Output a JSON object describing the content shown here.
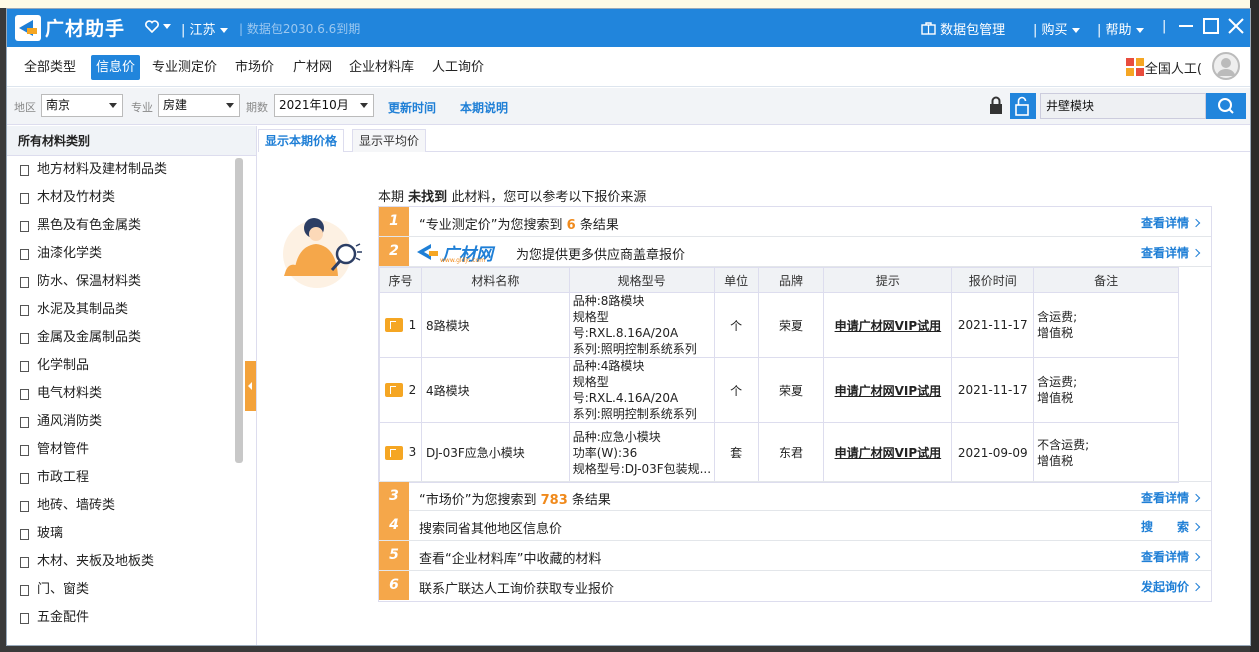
{
  "titlebar": {
    "app_name": "广材助手",
    "region": "江苏",
    "package_expiry": "数据包2030.6.6到期",
    "data_package_manage": "数据包管理",
    "buy": "购买",
    "help": "帮助"
  },
  "nav": {
    "tabs": [
      {
        "label": "全部类型"
      },
      {
        "label": "信息价"
      },
      {
        "label": "专业测定价"
      },
      {
        "label": "市场价"
      },
      {
        "label": "广材网"
      },
      {
        "label": "企业材料库"
      },
      {
        "label": "人工询价"
      }
    ],
    "right_label": "全国人工("
  },
  "filters": {
    "region_label": "地区",
    "region_value": "南京",
    "specialty_label": "专业",
    "specialty_value": "房建",
    "period_label": "期数",
    "period_value": "2021年10月",
    "update_time": "更新时间",
    "period_desc": "本期说明",
    "search_value": "井壁模块"
  },
  "sidebar": {
    "header": "所有材料类别",
    "items": [
      "地方材料及建材制品类",
      "木材及竹材类",
      "黑色及有色金属类",
      "油漆化学类",
      "防水、保温材料类",
      "水泥及其制品类",
      "金属及金属制品类",
      "化学制品",
      "电气材料类",
      "通风消防类",
      "管材管件",
      "市政工程",
      "地砖、墙砖类",
      "玻璃",
      "木材、夹板及地板类",
      "门、窗类",
      "五金配件"
    ]
  },
  "main": {
    "subtabs": [
      "显示本期价格",
      "显示平均价"
    ],
    "notice_prefix": "本期",
    "notice_bold": "未找到",
    "notice_suffix": "此材料，您可以参考以下报价来源",
    "rows": [
      {
        "num": "1",
        "text_pre": "“专业测定价”为您搜索到",
        "count": "6",
        "text_post": "条结果",
        "link": "查看详情"
      },
      {
        "num": "2",
        "logo_text": "广材网",
        "logo_sub": "www.gldjc.com",
        "text": "为您提供更多供应商盖章报价",
        "link": "查看详情"
      },
      {
        "num": "3",
        "text_pre": "“市场价”为您搜索到",
        "count": "783",
        "text_post": "条结果",
        "link": "查看详情"
      },
      {
        "num": "4",
        "text": "搜索同省其他地区信息价",
        "link": "搜　　索"
      },
      {
        "num": "5",
        "text": "查看“企业材料库”中收藏的材料",
        "link": "查看详情"
      },
      {
        "num": "6",
        "text": "联系广联达人工询价获取专业报价",
        "link": "发起询价"
      }
    ],
    "table": {
      "headers": [
        "序号",
        "材料名称",
        "规格型号",
        "单位",
        "品牌",
        "提示",
        "报价时间",
        "备注"
      ],
      "rows": [
        {
          "idx": "1",
          "name": "8路模块",
          "spec1": "品种:8路模块",
          "spec2": "规格型号:RXL.8.16A/20A",
          "spec3": "系列:照明控制系统系列",
          "unit": "个",
          "brand": "荣夏",
          "hint": "申请广材网VIP试用",
          "date": "2021-11-17",
          "note1": "含运费;",
          "note2": "增值税"
        },
        {
          "idx": "2",
          "name": "4路模块",
          "spec1": "品种:4路模块",
          "spec2": "规格型号:RXL.4.16A/20A",
          "spec3": "系列:照明控制系统系列",
          "unit": "个",
          "brand": "荣夏",
          "hint": "申请广材网VIP试用",
          "date": "2021-11-17",
          "note1": "含运费;",
          "note2": "增值税"
        },
        {
          "idx": "3",
          "name": "DJ-03F应急小模块",
          "spec1": "品种:应急小模块",
          "spec2": "功率(W):36",
          "spec3": "规格型号:DJ-03F包装规...",
          "unit": "套",
          "brand": "东君",
          "hint": "申请广材网VIP试用",
          "date": "2021-09-09",
          "note1": "不含运费;",
          "note2": "增值税"
        }
      ]
    }
  },
  "colors": {
    "brand_blue": "#2185dc",
    "accent_orange": "#f5a74a",
    "link_blue": "#1f7fd6"
  }
}
